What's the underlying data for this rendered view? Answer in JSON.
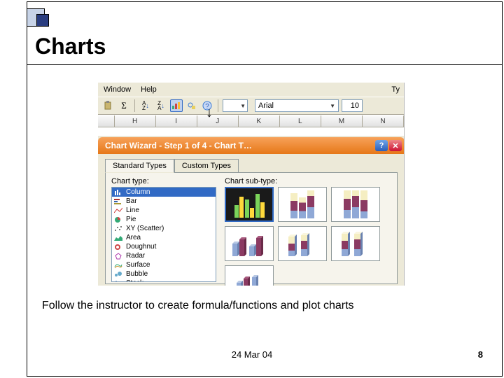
{
  "slide": {
    "title": "Charts",
    "instruction": "Follow the instructor to create formula/functions and plot charts",
    "date": "24 Mar 04",
    "page": "8"
  },
  "excelMenu": {
    "window": "Window",
    "help": "Help",
    "tyLabel": "Ty"
  },
  "toolbar": {
    "font": "Arial",
    "size": "10"
  },
  "columns": [
    "H",
    "I",
    "J",
    "K",
    "L",
    "M",
    "N"
  ],
  "wizard": {
    "title": "Chart Wizard - Step 1 of 4 - Chart T…",
    "help": "?",
    "close": "✕",
    "tabStandard": "Standard Types",
    "tabCustom": "Custom Types",
    "labelType": "Chart type:",
    "labelSubtype": "Chart sub-type:",
    "types": [
      "Column",
      "Bar",
      "Line",
      "Pie",
      "XY (Scatter)",
      "Area",
      "Doughnut",
      "Radar",
      "Surface",
      "Bubble",
      "Stock"
    ]
  }
}
